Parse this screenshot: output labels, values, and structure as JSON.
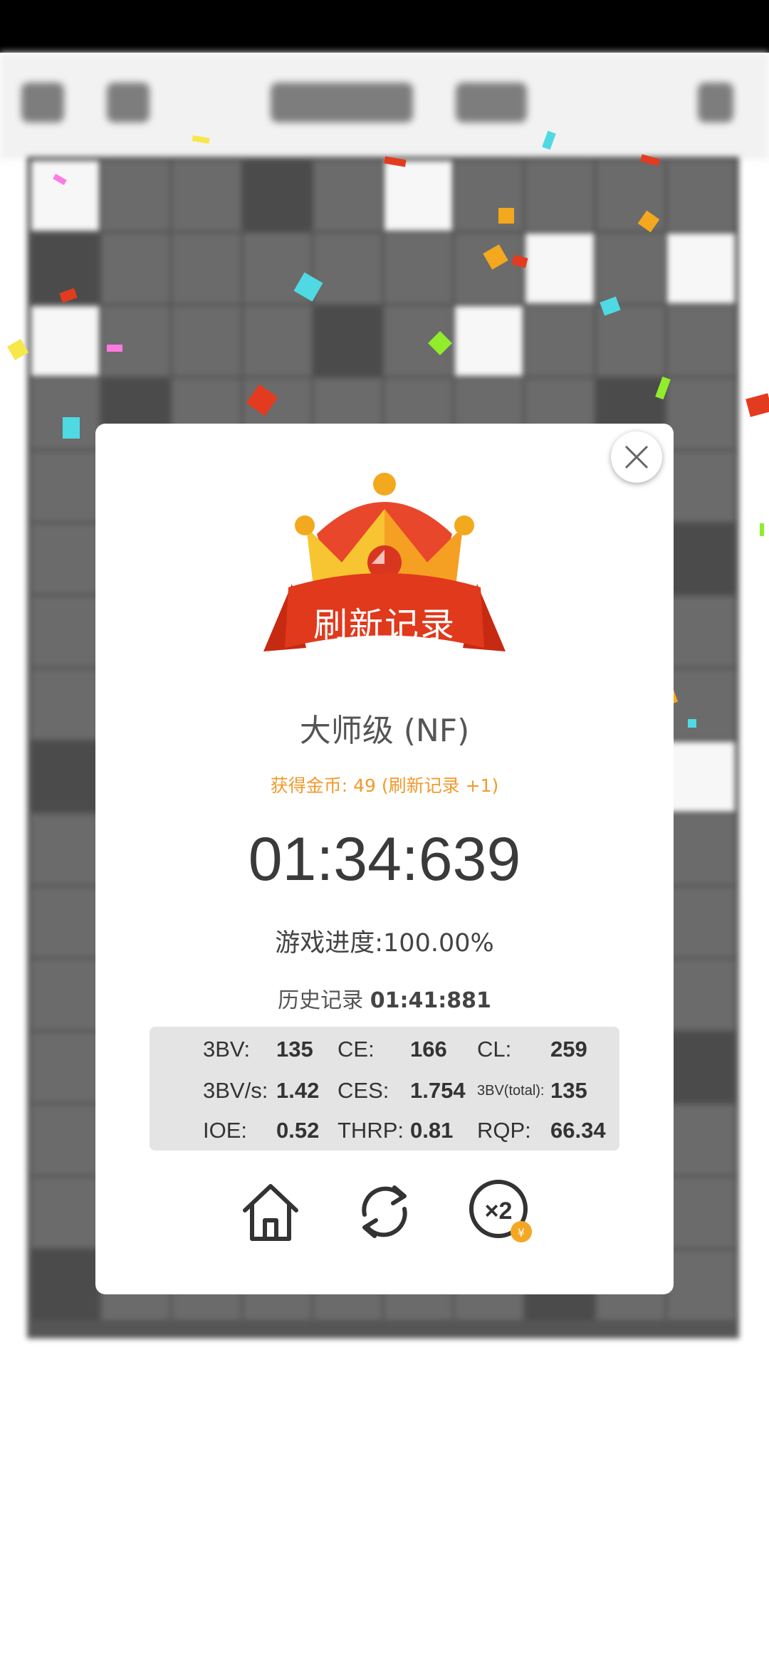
{
  "dialog": {
    "banner": "刷新记录",
    "level": "大师级 (NF)",
    "coins_text": "获得金币: 49 (刷新记录 +1)",
    "time": "01:34:639",
    "progress_label": "游戏进度:",
    "progress_value": "100.00%",
    "progress_fraction": 1.0,
    "history_label": "历史记录",
    "history_value": "01:41:881"
  },
  "stats": [
    {
      "label": "3BV:",
      "value": "135"
    },
    {
      "label": "CE:",
      "value": "166"
    },
    {
      "label": "CL:",
      "value": "259"
    },
    {
      "label": "3BV/s:",
      "value": "1.42"
    },
    {
      "label": "CES:",
      "value": "1.754"
    },
    {
      "label": "3BV(total):",
      "value": "135"
    },
    {
      "label": "IOE:",
      "value": "0.52"
    },
    {
      "label": "THRP:",
      "value": "0.81"
    },
    {
      "label": "RQP:",
      "value": "66.34"
    }
  ],
  "actions": {
    "home_icon": "home-icon",
    "restart_icon": "restart-icon",
    "double_icon": "double-coins-icon",
    "double_label": "×2",
    "coin_label": "¥"
  },
  "colors": {
    "coin_text": "#f29a2c",
    "banner_red": "#e0391c",
    "crown_yellow": "#f7c531",
    "crown_orange": "#f5a023"
  }
}
